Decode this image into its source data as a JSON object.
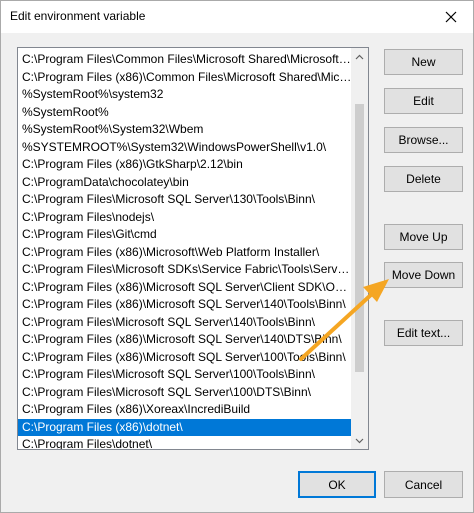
{
  "window": {
    "title": "Edit environment variable"
  },
  "paths": [
    "C:\\Program Files\\Common Files\\Microsoft Shared\\Microsoft O...",
    "C:\\Program Files (x86)\\Common Files\\Microsoft Shared\\Micros...",
    "%SystemRoot%\\system32",
    "%SystemRoot%",
    "%SystemRoot%\\System32\\Wbem",
    "%SYSTEMROOT%\\System32\\WindowsPowerShell\\v1.0\\",
    "C:\\Program Files (x86)\\GtkSharp\\2.12\\bin",
    "C:\\ProgramData\\chocolatey\\bin",
    "C:\\Program Files\\Microsoft SQL Server\\130\\Tools\\Binn\\",
    "C:\\Program Files\\nodejs\\",
    "C:\\Program Files\\Git\\cmd",
    "C:\\Program Files (x86)\\Microsoft\\Web Platform Installer\\",
    "C:\\Program Files\\Microsoft SDKs\\Service Fabric\\Tools\\ServiceF...",
    "C:\\Program Files (x86)\\Microsoft SQL Server\\Client SDK\\ODBC...",
    "C:\\Program Files (x86)\\Microsoft SQL Server\\140\\Tools\\Binn\\",
    "C:\\Program Files\\Microsoft SQL Server\\140\\Tools\\Binn\\",
    "C:\\Program Files (x86)\\Microsoft SQL Server\\140\\DTS\\Binn\\",
    "C:\\Program Files (x86)\\Microsoft SQL Server\\100\\Tools\\Binn\\",
    "C:\\Program Files\\Microsoft SQL Server\\100\\Tools\\Binn\\",
    "C:\\Program Files\\Microsoft SQL Server\\100\\DTS\\Binn\\",
    "C:\\Program Files (x86)\\Xoreax\\IncrediBuild",
    "C:\\Program Files (x86)\\dotnet\\",
    "C:\\Program Files\\dotnet\\"
  ],
  "selected_index": 21,
  "buttons": {
    "new": "New",
    "edit": "Edit",
    "browse": "Browse...",
    "delete": "Delete",
    "move_up": "Move Up",
    "move_down": "Move Down",
    "edit_text": "Edit text...",
    "ok": "OK",
    "cancel": "Cancel"
  },
  "colors": {
    "selection": "#0078d7",
    "annotation_arrow": "#f5a623"
  },
  "icons": {
    "close": "close-icon",
    "scroll_up": "chevron-up-icon",
    "scroll_down": "chevron-down-icon"
  }
}
